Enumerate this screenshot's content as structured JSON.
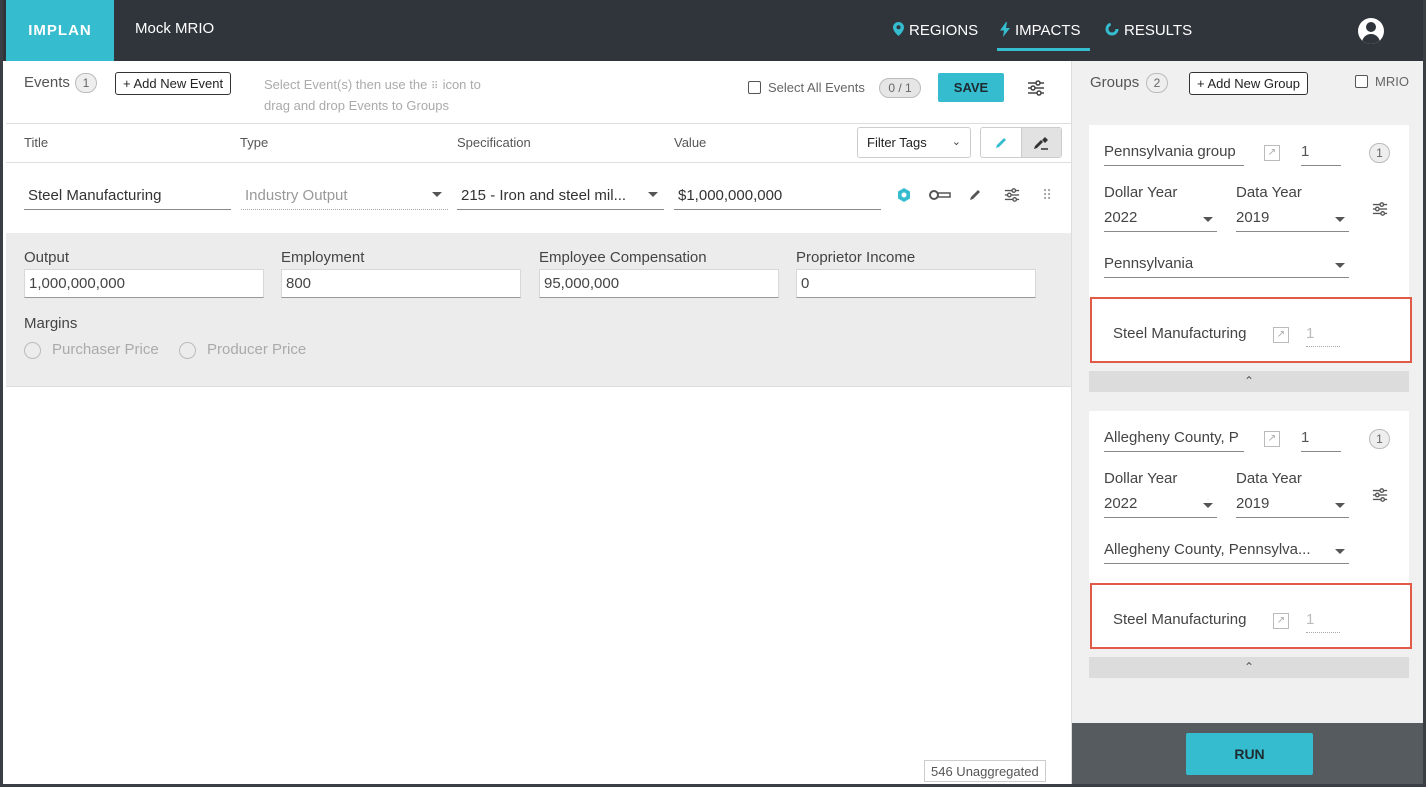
{
  "header": {
    "logo": "IMPLAN",
    "project_title": "Mock MRIO",
    "nav": {
      "regions": "REGIONS",
      "impacts": "IMPACTS",
      "results": "RESULTS"
    }
  },
  "events": {
    "label": "Events",
    "count": "1",
    "add_button": "+ Add New Event",
    "hint_line1": "Select Event(s) then use the",
    "hint_line1b": "icon to",
    "hint_line2": "drag and drop Events to Groups",
    "select_all": "Select All Events",
    "selected_count": "0 / 1",
    "save": "SAVE",
    "columns": {
      "title": "Title",
      "type": "Type",
      "specification": "Specification",
      "value": "Value"
    },
    "filter_tags": "Filter Tags",
    "row": {
      "title": "Steel Manufacturing",
      "type": "Industry Output",
      "specification": "215 - Iron and steel mil...",
      "value": "$1,000,000,000"
    },
    "detail": {
      "output_label": "Output",
      "output_value": "1,000,000,000",
      "employment_label": "Employment",
      "employment_value": "800",
      "comp_label": "Employee Compensation",
      "comp_value": "95,000,000",
      "prop_label": "Proprietor Income",
      "prop_value": "0",
      "margins_label": "Margins",
      "purchaser": "Purchaser Price",
      "producer": "Producer Price"
    },
    "unaggregated": "546 Unaggregated"
  },
  "groups": {
    "label": "Groups",
    "count": "2",
    "add_button": "+ Add New Group",
    "mrio": "MRIO",
    "items": [
      {
        "name": "Pennsylvania group",
        "scale": "1",
        "badge": "1",
        "dollar_year_label": "Dollar Year",
        "dollar_year": "2022",
        "data_year_label": "Data Year",
        "data_year": "2019",
        "region": "Pennsylvania",
        "event_name": "Steel Manufacturing",
        "event_scale": "1"
      },
      {
        "name": "Allegheny County, P",
        "scale": "1",
        "badge": "1",
        "dollar_year_label": "Dollar Year",
        "dollar_year": "2022",
        "data_year_label": "Data Year",
        "data_year": "2019",
        "region": "Allegheny County, Pennsylva...",
        "event_name": "Steel Manufacturing",
        "event_scale": "1"
      }
    ],
    "run": "RUN"
  },
  "colors": {
    "accent": "#35bccf",
    "topbar": "#2f353b",
    "highlight": "#e05a47"
  }
}
